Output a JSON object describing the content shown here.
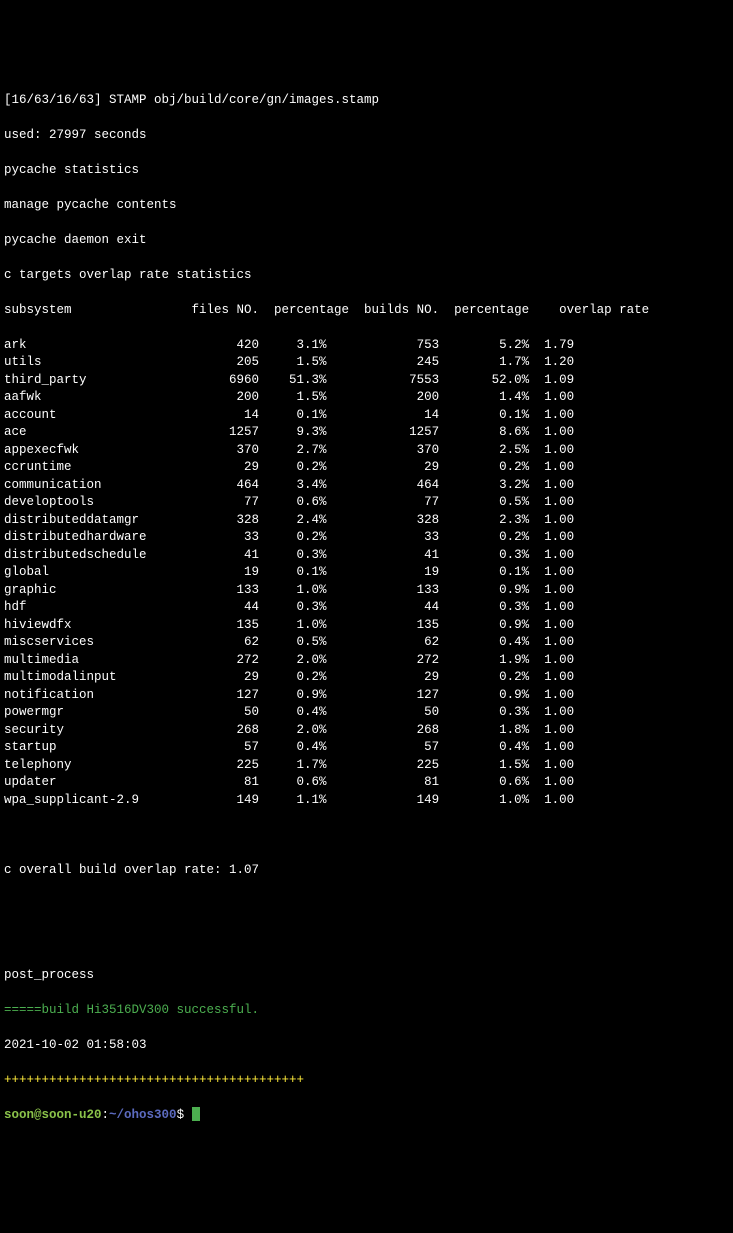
{
  "header": {
    "stamp": "[16/63/16/63] STAMP obj/build/core/gn/images.stamp",
    "used": "used: 27997 seconds",
    "pycache_stats": "pycache statistics",
    "manage_pycache": "manage pycache contents",
    "pycache_exit": "pycache daemon exit",
    "c_targets": "c targets overlap rate statistics"
  },
  "columns": {
    "subsystem": "subsystem",
    "files_no": "files NO.",
    "percentage1": "percentage",
    "builds_no": "builds NO.",
    "percentage2": "percentage",
    "overlap_rate": "overlap rate"
  },
  "rows": [
    {
      "name": "ark",
      "files": "420",
      "pct1": "3.1%",
      "builds": "753",
      "pct2": "5.2%",
      "rate": "1.79"
    },
    {
      "name": "utils",
      "files": "205",
      "pct1": "1.5%",
      "builds": "245",
      "pct2": "1.7%",
      "rate": "1.20"
    },
    {
      "name": "third_party",
      "files": "6960",
      "pct1": "51.3%",
      "builds": "7553",
      "pct2": "52.0%",
      "rate": "1.09"
    },
    {
      "name": "aafwk",
      "files": "200",
      "pct1": "1.5%",
      "builds": "200",
      "pct2": "1.4%",
      "rate": "1.00"
    },
    {
      "name": "account",
      "files": "14",
      "pct1": "0.1%",
      "builds": "14",
      "pct2": "0.1%",
      "rate": "1.00"
    },
    {
      "name": "ace",
      "files": "1257",
      "pct1": "9.3%",
      "builds": "1257",
      "pct2": "8.6%",
      "rate": "1.00"
    },
    {
      "name": "appexecfwk",
      "files": "370",
      "pct1": "2.7%",
      "builds": "370",
      "pct2": "2.5%",
      "rate": "1.00"
    },
    {
      "name": "ccruntime",
      "files": "29",
      "pct1": "0.2%",
      "builds": "29",
      "pct2": "0.2%",
      "rate": "1.00"
    },
    {
      "name": "communication",
      "files": "464",
      "pct1": "3.4%",
      "builds": "464",
      "pct2": "3.2%",
      "rate": "1.00"
    },
    {
      "name": "developtools",
      "files": "77",
      "pct1": "0.6%",
      "builds": "77",
      "pct2": "0.5%",
      "rate": "1.00"
    },
    {
      "name": "distributeddatamgr",
      "files": "328",
      "pct1": "2.4%",
      "builds": "328",
      "pct2": "2.3%",
      "rate": "1.00"
    },
    {
      "name": "distributedhardware",
      "files": "33",
      "pct1": "0.2%",
      "builds": "33",
      "pct2": "0.2%",
      "rate": "1.00"
    },
    {
      "name": "distributedschedule",
      "files": "41",
      "pct1": "0.3%",
      "builds": "41",
      "pct2": "0.3%",
      "rate": "1.00"
    },
    {
      "name": "global",
      "files": "19",
      "pct1": "0.1%",
      "builds": "19",
      "pct2": "0.1%",
      "rate": "1.00"
    },
    {
      "name": "graphic",
      "files": "133",
      "pct1": "1.0%",
      "builds": "133",
      "pct2": "0.9%",
      "rate": "1.00"
    },
    {
      "name": "hdf",
      "files": "44",
      "pct1": "0.3%",
      "builds": "44",
      "pct2": "0.3%",
      "rate": "1.00"
    },
    {
      "name": "hiviewdfx",
      "files": "135",
      "pct1": "1.0%",
      "builds": "135",
      "pct2": "0.9%",
      "rate": "1.00"
    },
    {
      "name": "miscservices",
      "files": "62",
      "pct1": "0.5%",
      "builds": "62",
      "pct2": "0.4%",
      "rate": "1.00"
    },
    {
      "name": "multimedia",
      "files": "272",
      "pct1": "2.0%",
      "builds": "272",
      "pct2": "1.9%",
      "rate": "1.00"
    },
    {
      "name": "multimodalinput",
      "files": "29",
      "pct1": "0.2%",
      "builds": "29",
      "pct2": "0.2%",
      "rate": "1.00"
    },
    {
      "name": "notification",
      "files": "127",
      "pct1": "0.9%",
      "builds": "127",
      "pct2": "0.9%",
      "rate": "1.00"
    },
    {
      "name": "powermgr",
      "files": "50",
      "pct1": "0.4%",
      "builds": "50",
      "pct2": "0.3%",
      "rate": "1.00"
    },
    {
      "name": "security",
      "files": "268",
      "pct1": "2.0%",
      "builds": "268",
      "pct2": "1.8%",
      "rate": "1.00"
    },
    {
      "name": "startup",
      "files": "57",
      "pct1": "0.4%",
      "builds": "57",
      "pct2": "0.4%",
      "rate": "1.00"
    },
    {
      "name": "telephony",
      "files": "225",
      "pct1": "1.7%",
      "builds": "225",
      "pct2": "1.5%",
      "rate": "1.00"
    },
    {
      "name": "updater",
      "files": "81",
      "pct1": "0.6%",
      "builds": "81",
      "pct2": "0.6%",
      "rate": "1.00"
    },
    {
      "name": "wpa_supplicant-2.9",
      "files": "149",
      "pct1": "1.1%",
      "builds": "149",
      "pct2": "1.0%",
      "rate": "1.00"
    }
  ],
  "footer": {
    "overall": "c overall build overlap rate: 1.07",
    "post_process": "post_process",
    "success_prefix": "=====",
    "success_msg": "build Hi3516DV300 successful.",
    "timestamp": "2021-10-02 01:58:03",
    "dashes": "++++++++++++++++++++++++++++++++++++++++"
  },
  "prompt": {
    "user_host": "soon@soon-u20",
    "colon": ":",
    "path": "~/ohos300",
    "dollar": "$ "
  }
}
